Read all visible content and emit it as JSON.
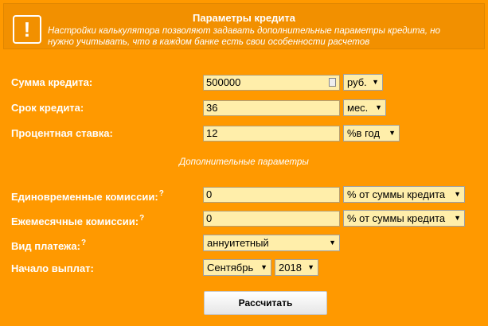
{
  "header": {
    "title": "Параметры кредита",
    "description": "Настройки калькулятора позволяют задавать дополнительные параметры кредита, но нужно учитывать, что в каждом банке есть свои особенности расчетов",
    "icon": "exclamation-icon"
  },
  "amount": {
    "label": "Сумма кредита:",
    "value": "500000",
    "unit": "руб."
  },
  "term": {
    "label": "Срок кредита:",
    "value": "36",
    "unit": "мес."
  },
  "rate": {
    "label": "Процентная ставка:",
    "value": "12",
    "unit": "%в год"
  },
  "extra_title": "Дополнительные параметры",
  "one_time_fee": {
    "label": "Единовременные комиссии:",
    "hint": "?",
    "value": "0",
    "unit": "% от суммы кредита"
  },
  "monthly_fee": {
    "label": "Ежемесячные комиссии:",
    "hint": "?",
    "value": "0",
    "unit": "% от суммы кредита"
  },
  "payment_type": {
    "label": "Вид платежа:",
    "hint": "?",
    "value": "аннуитетный"
  },
  "start": {
    "label": "Начало выплат:",
    "month": "Сентябрь",
    "year": "2018"
  },
  "calculate_label": "Рассчитать",
  "colors": {
    "background": "#ff9900",
    "input": "#ffeeaa",
    "header": "#f29000"
  }
}
